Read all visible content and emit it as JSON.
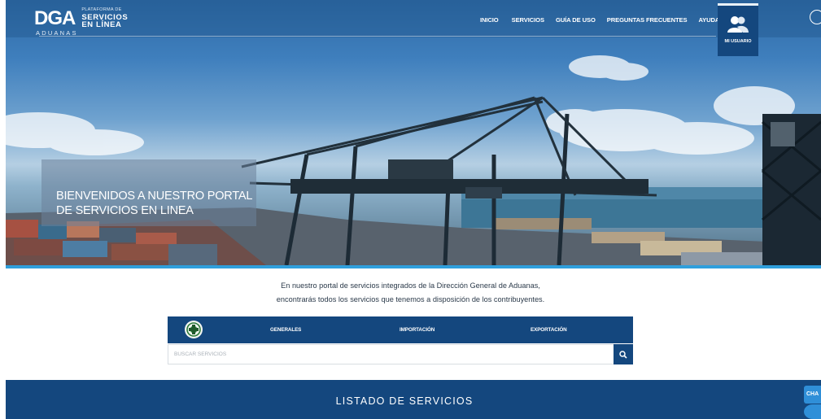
{
  "logo": {
    "mark": "DGA",
    "sub": "ADUANAS",
    "platform": "PLATAFORMA DE",
    "services": "SERVICIOS",
    "online": "EN LÍNEA"
  },
  "nav": {
    "items": [
      "INICIO",
      "SERVICIOS",
      "GUÍA DE USO",
      "PREGUNTAS FRECUENTES",
      "AYUDA"
    ],
    "user_label": "MI USUARIO"
  },
  "hero": {
    "welcome_line1": "BIENVENIDOS A NUESTRO PORTAL",
    "welcome_line2": "DE SERVICIOS EN LINEA"
  },
  "intro": {
    "line1": "En nuestro portal de servicios integrados de la Dirección General de Aduanas,",
    "line2": "encontrarás todos los servicios que tenemos a disposición de los contribuyentes."
  },
  "tabs": {
    "items": [
      "GENERALES",
      "IMPORTACIÓN",
      "EXPORTACIÓN"
    ]
  },
  "search": {
    "placeholder": "BUSCAR SERVICIOS"
  },
  "listado": {
    "title": "LISTADO DE SERVICIOS"
  },
  "chat": {
    "label": "CHA"
  },
  "colors": {
    "navy": "#14477e",
    "accent_blue": "#2f9fdc",
    "chat_blue": "#2f8fd8"
  }
}
